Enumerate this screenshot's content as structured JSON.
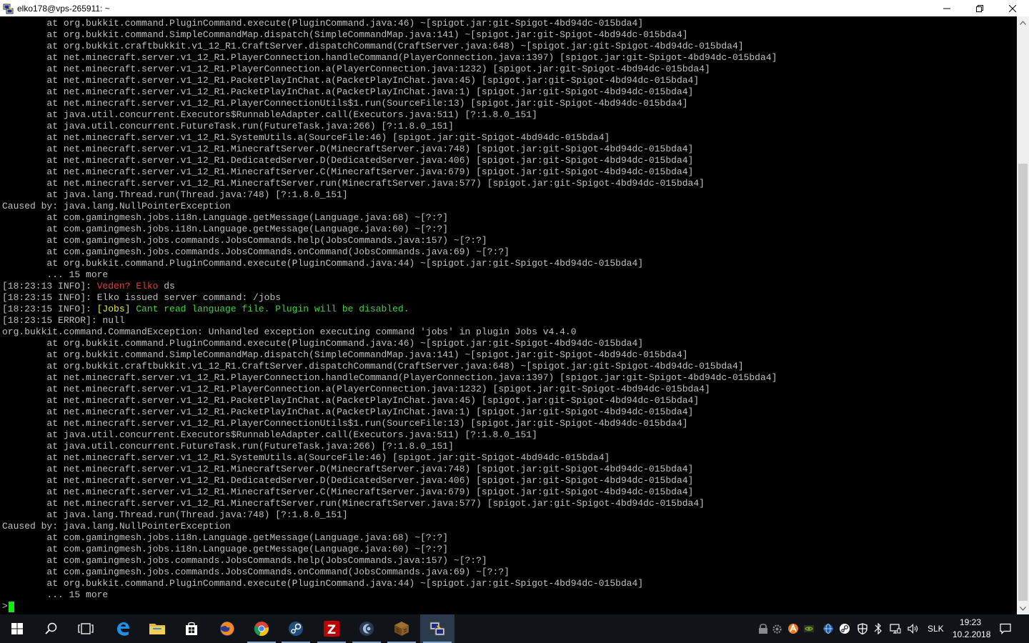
{
  "window": {
    "title": "elko178@vps-265911: ~",
    "icons": {
      "app": "putty-icon",
      "minimize": "minimize-icon",
      "maximize": "restore-icon",
      "close": "close-icon"
    }
  },
  "terminal": {
    "prompt": ">",
    "lines": [
      {
        "segments": [
          {
            "t": "        at org.bukkit.command.PluginCommand.execute(PluginCommand.java:46) ~[spigot.jar:git-Spigot-4bd94dc-015bda4]",
            "c": ""
          }
        ]
      },
      {
        "segments": [
          {
            "t": "        at org.bukkit.command.SimpleCommandMap.dispatch(SimpleCommandMap.java:141) ~[spigot.jar:git-Spigot-4bd94dc-015bda4]",
            "c": ""
          }
        ]
      },
      {
        "segments": [
          {
            "t": "        at org.bukkit.craftbukkit.v1_12_R1.CraftServer.dispatchCommand(CraftServer.java:648) ~[spigot.jar:git-Spigot-4bd94dc-015bda4]",
            "c": ""
          }
        ]
      },
      {
        "segments": [
          {
            "t": "        at net.minecraft.server.v1_12_R1.PlayerConnection.handleCommand(PlayerConnection.java:1397) [spigot.jar:git-Spigot-4bd94dc-015bda4]",
            "c": ""
          }
        ]
      },
      {
        "segments": [
          {
            "t": "        at net.minecraft.server.v1_12_R1.PlayerConnection.a(PlayerConnection.java:1232) [spigot.jar:git-Spigot-4bd94dc-015bda4]",
            "c": ""
          }
        ]
      },
      {
        "segments": [
          {
            "t": "        at net.minecraft.server.v1_12_R1.PacketPlayInChat.a(PacketPlayInChat.java:45) [spigot.jar:git-Spigot-4bd94dc-015bda4]",
            "c": ""
          }
        ]
      },
      {
        "segments": [
          {
            "t": "        at net.minecraft.server.v1_12_R1.PacketPlayInChat.a(PacketPlayInChat.java:1) [spigot.jar:git-Spigot-4bd94dc-015bda4]",
            "c": ""
          }
        ]
      },
      {
        "segments": [
          {
            "t": "        at net.minecraft.server.v1_12_R1.PlayerConnectionUtils$1.run(SourceFile:13) [spigot.jar:git-Spigot-4bd94dc-015bda4]",
            "c": ""
          }
        ]
      },
      {
        "segments": [
          {
            "t": "        at java.util.concurrent.Executors$RunnableAdapter.call(Executors.java:511) [?:1.8.0_151]",
            "c": ""
          }
        ]
      },
      {
        "segments": [
          {
            "t": "        at java.util.concurrent.FutureTask.run(FutureTask.java:266) [?:1.8.0_151]",
            "c": ""
          }
        ]
      },
      {
        "segments": [
          {
            "t": "        at net.minecraft.server.v1_12_R1.SystemUtils.a(SourceFile:46) [spigot.jar:git-Spigot-4bd94dc-015bda4]",
            "c": ""
          }
        ]
      },
      {
        "segments": [
          {
            "t": "        at net.minecraft.server.v1_12_R1.MinecraftServer.D(MinecraftServer.java:748) [spigot.jar:git-Spigot-4bd94dc-015bda4]",
            "c": ""
          }
        ]
      },
      {
        "segments": [
          {
            "t": "        at net.minecraft.server.v1_12_R1.DedicatedServer.D(DedicatedServer.java:406) [spigot.jar:git-Spigot-4bd94dc-015bda4]",
            "c": ""
          }
        ]
      },
      {
        "segments": [
          {
            "t": "        at net.minecraft.server.v1_12_R1.MinecraftServer.C(MinecraftServer.java:679) [spigot.jar:git-Spigot-4bd94dc-015bda4]",
            "c": ""
          }
        ]
      },
      {
        "segments": [
          {
            "t": "        at net.minecraft.server.v1_12_R1.MinecraftServer.run(MinecraftServer.java:577) [spigot.jar:git-Spigot-4bd94dc-015bda4]",
            "c": ""
          }
        ]
      },
      {
        "segments": [
          {
            "t": "        at java.lang.Thread.run(Thread.java:748) [?:1.8.0_151]",
            "c": ""
          }
        ]
      },
      {
        "segments": [
          {
            "t": "Caused by: java.lang.NullPointerException",
            "c": ""
          }
        ]
      },
      {
        "segments": [
          {
            "t": "        at com.gamingmesh.jobs.i18n.Language.getMessage(Language.java:68) ~[?:?]",
            "c": ""
          }
        ]
      },
      {
        "segments": [
          {
            "t": "        at com.gamingmesh.jobs.i18n.Language.getMessage(Language.java:60) ~[?:?]",
            "c": ""
          }
        ]
      },
      {
        "segments": [
          {
            "t": "        at com.gamingmesh.jobs.commands.JobsCommands.help(JobsCommands.java:157) ~[?:?]",
            "c": ""
          }
        ]
      },
      {
        "segments": [
          {
            "t": "        at com.gamingmesh.jobs.commands.JobsCommands.onCommand(JobsCommands.java:69) ~[?:?]",
            "c": ""
          }
        ]
      },
      {
        "segments": [
          {
            "t": "        at org.bukkit.command.PluginCommand.execute(PluginCommand.java:44) ~[spigot.jar:git-Spigot-4bd94dc-015bda4]",
            "c": ""
          }
        ]
      },
      {
        "segments": [
          {
            "t": "        ... 15 more",
            "c": ""
          }
        ]
      },
      {
        "segments": [
          {
            "t": "[18:23:13 INFO]: ",
            "c": ""
          },
          {
            "t": "Veden? Elko",
            "c": "red"
          },
          {
            "t": " ds",
            "c": ""
          }
        ]
      },
      {
        "segments": [
          {
            "t": "[18:23:15 INFO]: Elko issued server command: /jobs",
            "c": ""
          }
        ]
      },
      {
        "segments": [
          {
            "t": "[18:23:15 INFO]: ",
            "c": ""
          },
          {
            "t": "[Jobs]",
            "c": "yellow"
          },
          {
            "t": " Cant read language file. Plugin will be disabled.",
            "c": "green"
          }
        ]
      },
      {
        "segments": [
          {
            "t": "[18:23:15 ERROR]: null",
            "c": ""
          }
        ]
      },
      {
        "segments": [
          {
            "t": "org.bukkit.command.CommandException: Unhandled exception executing command 'jobs' in plugin Jobs v4.4.0",
            "c": ""
          }
        ]
      },
      {
        "segments": [
          {
            "t": "        at org.bukkit.command.PluginCommand.execute(PluginCommand.java:46) ~[spigot.jar:git-Spigot-4bd94dc-015bda4]",
            "c": ""
          }
        ]
      },
      {
        "segments": [
          {
            "t": "        at org.bukkit.command.SimpleCommandMap.dispatch(SimpleCommandMap.java:141) ~[spigot.jar:git-Spigot-4bd94dc-015bda4]",
            "c": ""
          }
        ]
      },
      {
        "segments": [
          {
            "t": "        at org.bukkit.craftbukkit.v1_12_R1.CraftServer.dispatchCommand(CraftServer.java:648) ~[spigot.jar:git-Spigot-4bd94dc-015bda4]",
            "c": ""
          }
        ]
      },
      {
        "segments": [
          {
            "t": "        at net.minecraft.server.v1_12_R1.PlayerConnection.handleCommand(PlayerConnection.java:1397) [spigot.jar:git-Spigot-4bd94dc-015bda4]",
            "c": ""
          }
        ]
      },
      {
        "segments": [
          {
            "t": "        at net.minecraft.server.v1_12_R1.PlayerConnection.a(PlayerConnection.java:1232) [spigot.jar:git-Spigot-4bd94dc-015bda4]",
            "c": ""
          }
        ]
      },
      {
        "segments": [
          {
            "t": "        at net.minecraft.server.v1_12_R1.PacketPlayInChat.a(PacketPlayInChat.java:45) [spigot.jar:git-Spigot-4bd94dc-015bda4]",
            "c": ""
          }
        ]
      },
      {
        "segments": [
          {
            "t": "        at net.minecraft.server.v1_12_R1.PacketPlayInChat.a(PacketPlayInChat.java:1) [spigot.jar:git-Spigot-4bd94dc-015bda4]",
            "c": ""
          }
        ]
      },
      {
        "segments": [
          {
            "t": "        at net.minecraft.server.v1_12_R1.PlayerConnectionUtils$1.run(SourceFile:13) [spigot.jar:git-Spigot-4bd94dc-015bda4]",
            "c": ""
          }
        ]
      },
      {
        "segments": [
          {
            "t": "        at java.util.concurrent.Executors$RunnableAdapter.call(Executors.java:511) [?:1.8.0_151]",
            "c": ""
          }
        ]
      },
      {
        "segments": [
          {
            "t": "        at java.util.concurrent.FutureTask.run(FutureTask.java:266) [?:1.8.0_151]",
            "c": ""
          }
        ]
      },
      {
        "segments": [
          {
            "t": "        at net.minecraft.server.v1_12_R1.SystemUtils.a(SourceFile:46) [spigot.jar:git-Spigot-4bd94dc-015bda4]",
            "c": ""
          }
        ]
      },
      {
        "segments": [
          {
            "t": "        at net.minecraft.server.v1_12_R1.MinecraftServer.D(MinecraftServer.java:748) [spigot.jar:git-Spigot-4bd94dc-015bda4]",
            "c": ""
          }
        ]
      },
      {
        "segments": [
          {
            "t": "        at net.minecraft.server.v1_12_R1.DedicatedServer.D(DedicatedServer.java:406) [spigot.jar:git-Spigot-4bd94dc-015bda4]",
            "c": ""
          }
        ]
      },
      {
        "segments": [
          {
            "t": "        at net.minecraft.server.v1_12_R1.MinecraftServer.C(MinecraftServer.java:679) [spigot.jar:git-Spigot-4bd94dc-015bda4]",
            "c": ""
          }
        ]
      },
      {
        "segments": [
          {
            "t": "        at net.minecraft.server.v1_12_R1.MinecraftServer.run(MinecraftServer.java:577) [spigot.jar:git-Spigot-4bd94dc-015bda4]",
            "c": ""
          }
        ]
      },
      {
        "segments": [
          {
            "t": "        at java.lang.Thread.run(Thread.java:748) [?:1.8.0_151]",
            "c": ""
          }
        ]
      },
      {
        "segments": [
          {
            "t": "Caused by: java.lang.NullPointerException",
            "c": ""
          }
        ]
      },
      {
        "segments": [
          {
            "t": "        at com.gamingmesh.jobs.i18n.Language.getMessage(Language.java:68) ~[?:?]",
            "c": ""
          }
        ]
      },
      {
        "segments": [
          {
            "t": "        at com.gamingmesh.jobs.i18n.Language.getMessage(Language.java:60) ~[?:?]",
            "c": ""
          }
        ]
      },
      {
        "segments": [
          {
            "t": "        at com.gamingmesh.jobs.commands.JobsCommands.help(JobsCommands.java:157) ~[?:?]",
            "c": ""
          }
        ]
      },
      {
        "segments": [
          {
            "t": "        at com.gamingmesh.jobs.commands.JobsCommands.onCommand(JobsCommands.java:69) ~[?:?]",
            "c": ""
          }
        ]
      },
      {
        "segments": [
          {
            "t": "        at org.bukkit.command.PluginCommand.execute(PluginCommand.java:44) ~[spigot.jar:git-Spigot-4bd94dc-015bda4]",
            "c": ""
          }
        ]
      },
      {
        "segments": [
          {
            "t": "        ... 15 more",
            "c": ""
          }
        ]
      }
    ]
  },
  "taskbar": {
    "apps": [
      {
        "name": "start-button",
        "icon": "windows-logo-icon"
      },
      {
        "name": "search-button",
        "icon": "search-icon"
      },
      {
        "name": "task-view-button",
        "icon": "task-view-icon"
      },
      {
        "name": "edge-button",
        "icon": "edge-icon"
      },
      {
        "name": "file-explorer-button",
        "icon": "folder-icon"
      },
      {
        "name": "store-button",
        "icon": "store-icon"
      },
      {
        "name": "firefox-button",
        "icon": "firefox-icon"
      },
      {
        "name": "chrome-button",
        "icon": "chrome-icon"
      },
      {
        "name": "steam-button",
        "icon": "steam-icon"
      },
      {
        "name": "filezilla-button",
        "icon": "filezilla-icon"
      },
      {
        "name": "app-button",
        "icon": "app-icon"
      },
      {
        "name": "minecraft-button",
        "icon": "minecraft-icon"
      },
      {
        "name": "putty-button",
        "icon": "putty-icon"
      }
    ],
    "tray": {
      "language": "SLK",
      "time": "19:23",
      "date": "10.2.2018"
    }
  },
  "colors": {
    "terminal_bg": "#000000",
    "terminal_fg": "#c0c0c0",
    "red": "#e03c3c",
    "yellow": "#e8e83a",
    "green": "#3ed43e",
    "cursor": "#19e619",
    "taskbar_bg": "#101318"
  }
}
